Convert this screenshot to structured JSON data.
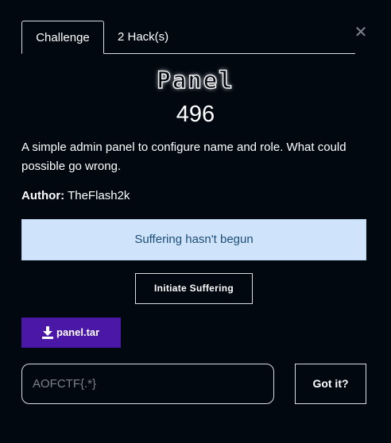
{
  "tabs": {
    "challenge_label": "Challenge",
    "hacks_label": "2 Hack(s)"
  },
  "close_glyph": "✕",
  "challenge": {
    "name": "Panel",
    "points": "496",
    "description": "A simple admin panel to configure name and role. What could possible go wrong.",
    "author_label": "Author:",
    "author_name": "TheFlash2k"
  },
  "instance": {
    "status_text": "Suffering hasn't begun",
    "start_button_label": "Initiate Suffering"
  },
  "attachment": {
    "file_label": "panel.tar",
    "icon": "download-icon"
  },
  "flag": {
    "placeholder": "AOFCTF{.*}",
    "value": "",
    "submit_label": "Got it?"
  },
  "colors": {
    "background": "#020810",
    "status_bg": "#cfe4fa",
    "status_text": "#1d4d7a",
    "download_bg": "#4a17a6"
  }
}
